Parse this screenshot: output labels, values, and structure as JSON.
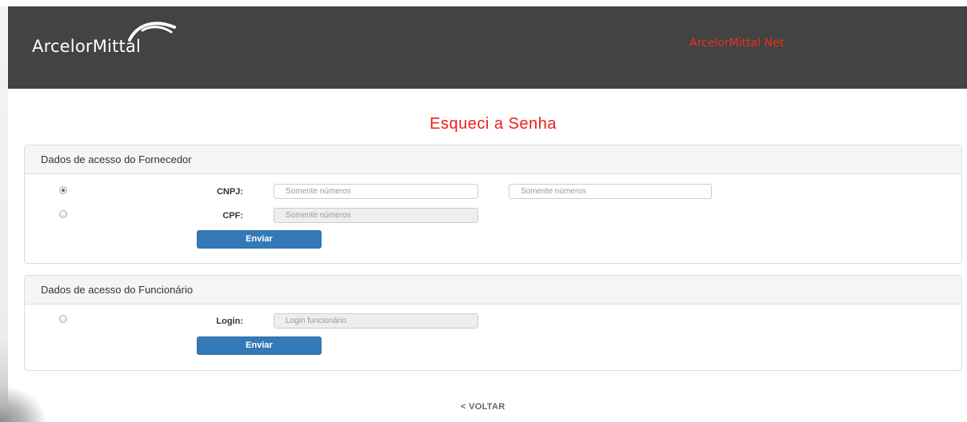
{
  "header": {
    "logo_text": "ArcelorMittal",
    "app_link": "ArcelorMittal Net"
  },
  "page": {
    "title": "Esqueci a Senha"
  },
  "fornecedor": {
    "heading": "Dados de acesso do Fornecedor",
    "cnpj_label": "CNPJ:",
    "cnpj_placeholder_1": "Somente números",
    "cnpj_placeholder_2": "Somente números",
    "cpf_label": "CPF:",
    "cpf_placeholder": "Somente números",
    "submit_label": "Enviar",
    "selected_option": "CNPJ"
  },
  "funcionario": {
    "heading": "Dados de acesso do Funcionário",
    "login_label": "Login:",
    "login_placeholder": "Login funcionário",
    "submit_label": "Enviar"
  },
  "footer": {
    "back_link": "< VOLTAR"
  },
  "colors": {
    "header_bg": "#434343",
    "accent_red": "#ee1c1c",
    "header_link": "#e8321e",
    "button_blue": "#337ab7"
  }
}
